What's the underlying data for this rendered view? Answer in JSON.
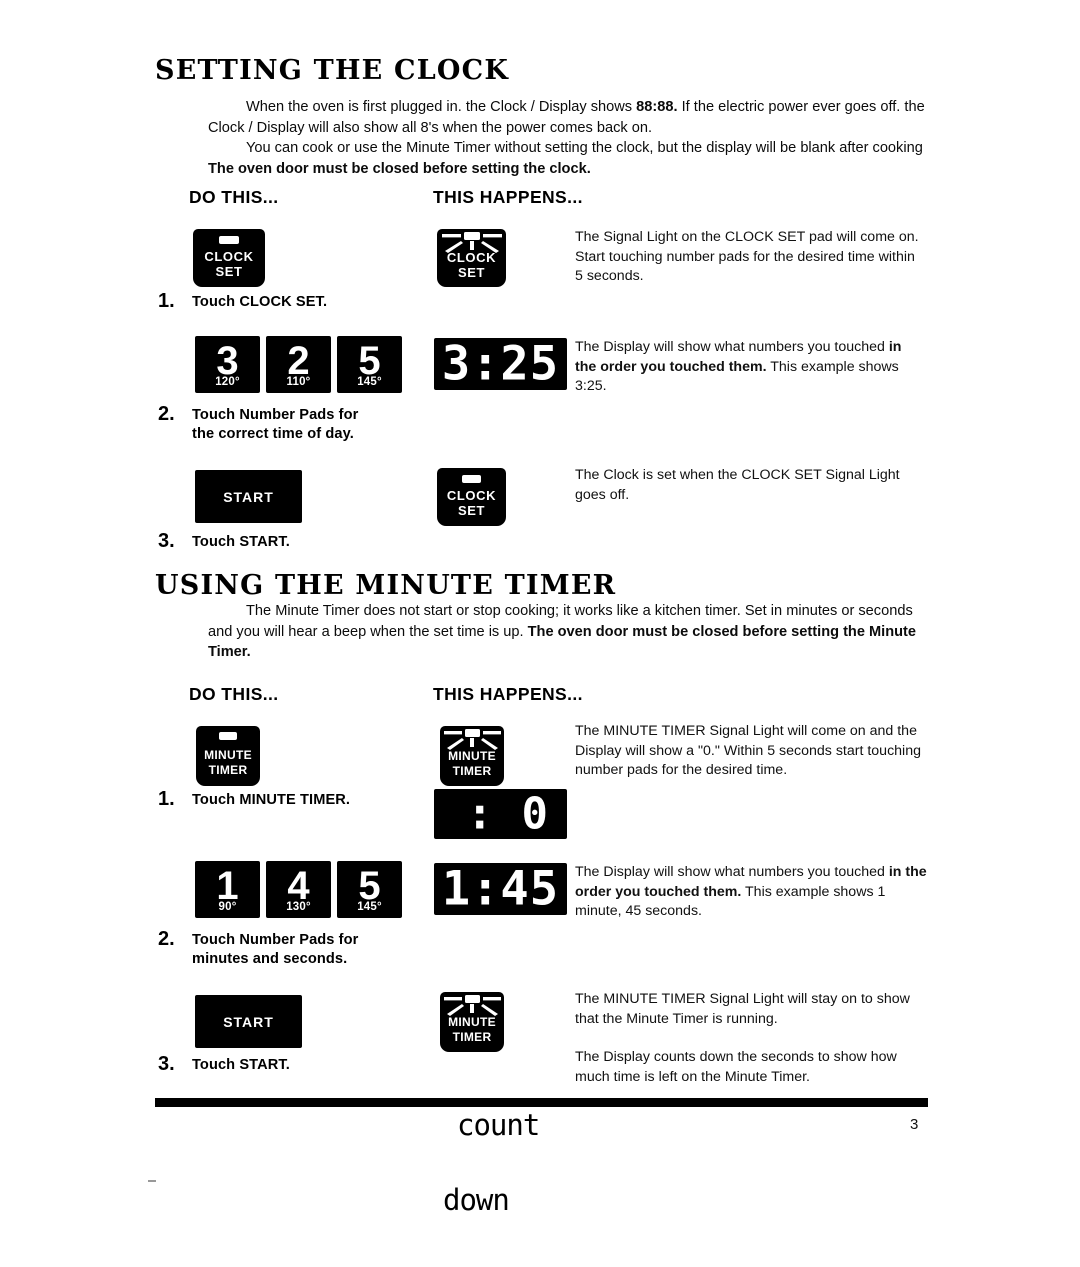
{
  "document": {
    "page_number": "3"
  },
  "clock_section": {
    "title": "SETTING THE CLOCK",
    "intro_p1_a": "When the oven is first plugged in. the Clock / Display shows ",
    "intro_p1_b": "88:88.",
    "intro_p1_c": " If the electric power ever goes off. the Clock / Display will also show all 8's when the power comes back on.",
    "intro_p2_a": "You can cook or use the Minute Timer without setting the clock, but the display will be blank after cooking ",
    "intro_p2_b": "The oven door must be closed before setting the clock.",
    "col_do": "DO THIS...",
    "col_happens": "THIS HAPPENS...",
    "steps": [
      {
        "number": "1.",
        "label": "Touch CLOCK SET.",
        "pad_line1": "CLOCK",
        "pad_line2": "SET",
        "result_pad_line1": "CLOCK",
        "result_pad_line2": "SET",
        "desc": "The Signal Light on the CLOCK SET pad will come on. Start touching number pads for the desired time within 5 seconds."
      },
      {
        "number": "2.",
        "label_line1": "Touch Number Pads for",
        "label_line2": "the correct time of day.",
        "numpads": [
          {
            "digit": "3",
            "temp": "120°"
          },
          {
            "digit": "2",
            "temp": "110°"
          },
          {
            "digit": "5",
            "temp": "145°"
          }
        ],
        "display": "3:25",
        "desc_a": "The Display will show what numbers you touched ",
        "desc_b": "in the order you touched them.",
        "desc_c": " This example shows 3:25."
      },
      {
        "number": "3.",
        "label": "Touch START.",
        "start_label": "START",
        "result_pad_line1": "CLOCK",
        "result_pad_line2": "SET",
        "desc": "The Clock is set when the CLOCK SET Signal Light goes off."
      }
    ]
  },
  "timer_section": {
    "title": "USING THE MINUTE TIMER",
    "intro_p1_a": "The Minute Timer does not start or stop cooking; it works like a kitchen timer. Set in minutes or seconds and you will hear a beep when the set time is up. ",
    "intro_p1_b": "The oven door must be closed before setting the Minute Timer.",
    "col_do": "DO THIS...",
    "col_happens": "THIS HAPPENS...",
    "steps": [
      {
        "number": "1.",
        "label": "Touch MINUTE TIMER.",
        "pad_line1": "MINUTE",
        "pad_line2": "TIMER",
        "result_pad_line1": "MINUTE",
        "result_pad_line2": "TIMER",
        "display": ": 0",
        "desc": "The MINUTE TIMER Signal Light will come on and the Display will show a \"0.\" Within 5 seconds start touching number pads for the desired time."
      },
      {
        "number": "2.",
        "label_line1": "Touch Number Pads for",
        "label_line2": "minutes and seconds.",
        "numpads": [
          {
            "digit": "1",
            "temp": "90°"
          },
          {
            "digit": "4",
            "temp": "130°"
          },
          {
            "digit": "5",
            "temp": "145°"
          }
        ],
        "display": "1:45",
        "desc_a": "The Display will show what numbers you touched ",
        "desc_b": "in the order you touched them.",
        "desc_c": " This example shows 1 minute, 45 seconds."
      },
      {
        "number": "3.",
        "label": "Touch START.",
        "start_label": "START",
        "result_pad_line1": "MINUTE",
        "result_pad_line2": "TIMER",
        "desc": "The MINUTE TIMER Signal Light will stay on to show that the Minute Timer is running.",
        "countdown_graphic_line1": "count",
        "countdown_graphic_line2": "down",
        "desc2": "The Display counts down the seconds to show how much time is left on the Minute Timer."
      }
    ]
  }
}
